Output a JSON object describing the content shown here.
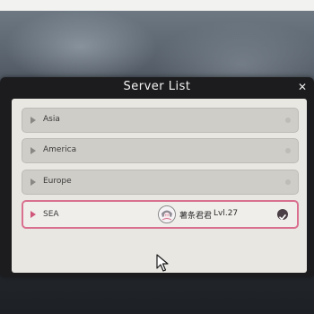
{
  "dialog": {
    "title": "Server List",
    "close_icon": "close-icon"
  },
  "servers": [
    {
      "name": "Asia",
      "selected": false
    },
    {
      "name": "America",
      "selected": false
    },
    {
      "name": "Europe",
      "selected": false
    },
    {
      "name": "SEA",
      "selected": true,
      "player_name": "薯条君君",
      "player_level": "Lvl.27"
    }
  ],
  "colors": {
    "accent": "#d9708f",
    "dialog_bg": "#1c1c1e",
    "panel_bg": "#e9e7e2",
    "row_bg": "#cfcdc8"
  }
}
